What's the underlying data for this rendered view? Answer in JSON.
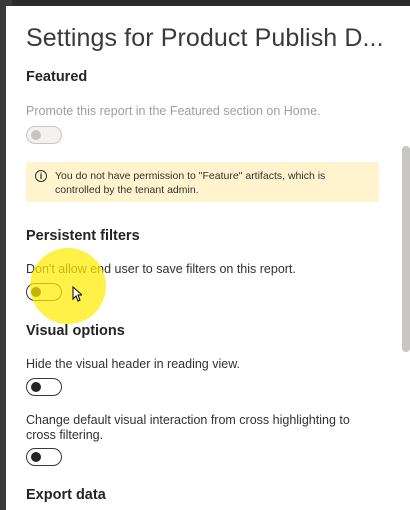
{
  "header": {
    "title": "Settings for Product Publish D..."
  },
  "featured": {
    "heading": "Featured",
    "description": "Promote this report in the Featured section on Home.",
    "toggle_on": false,
    "toggle_disabled": true
  },
  "warning": {
    "icon": "info-icon",
    "text": "You do not have permission to \"Feature\" artifacts, which is controlled by the tenant admin."
  },
  "persistent_filters": {
    "heading": "Persistent filters",
    "description": "Don't allow end user to save filters on this report.",
    "toggle_on": false
  },
  "visual_options": {
    "heading": "Visual options",
    "hide_header": {
      "description": "Hide the visual header in reading view.",
      "toggle_on": false
    },
    "cross_filtering": {
      "description": "Change default visual interaction from cross highlighting to cross filtering.",
      "toggle_on": false
    }
  },
  "export_data": {
    "heading": "Export data"
  },
  "colors": {
    "warning_bg": "#fff4ce",
    "highlight": "#ffec00",
    "text": "#252423"
  }
}
